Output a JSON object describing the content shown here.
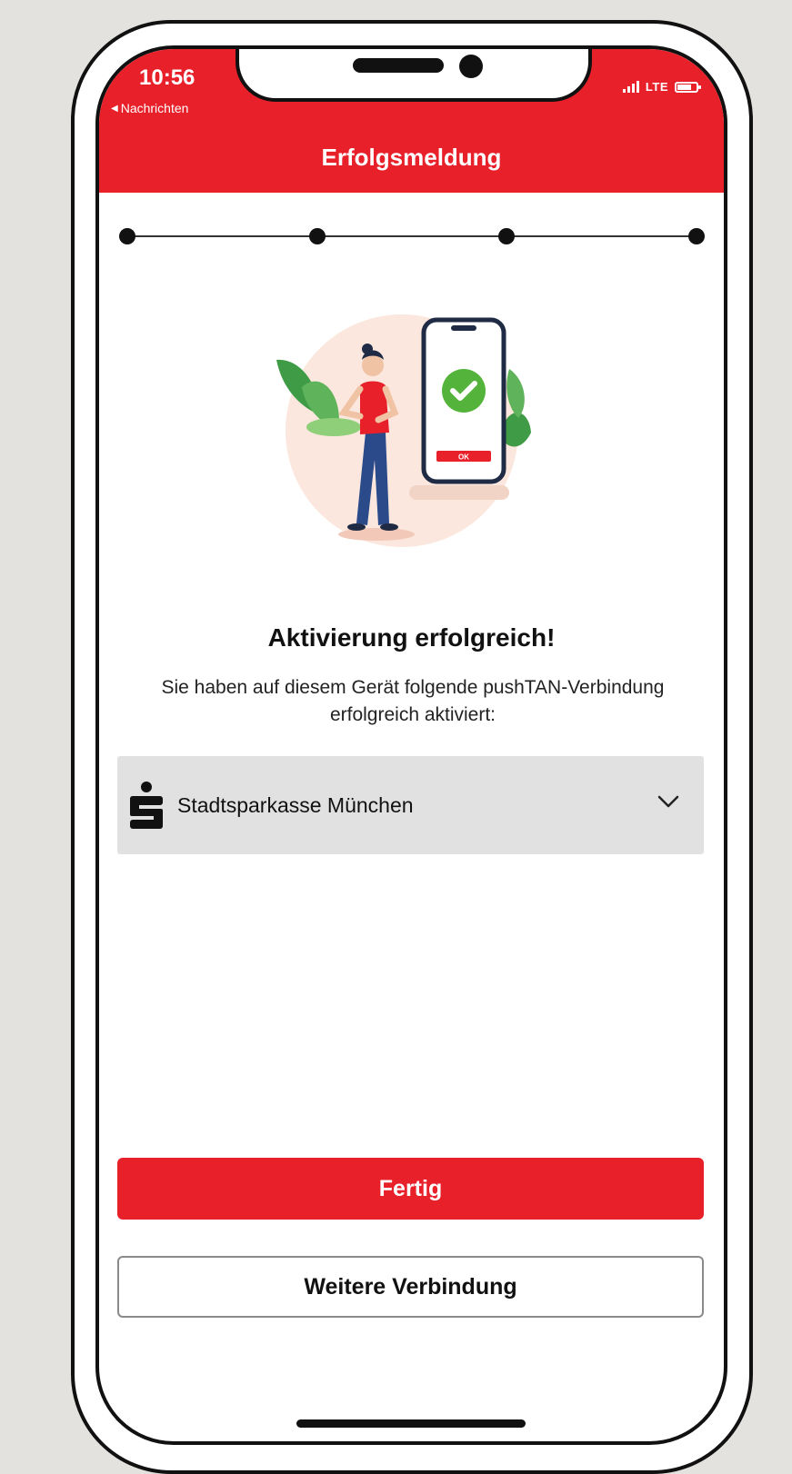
{
  "status_bar": {
    "time": "10:56",
    "back_label": "Nachrichten",
    "network": "LTE"
  },
  "header": {
    "title": "Erfolgsmeldung"
  },
  "stepper": {
    "total_steps": 4,
    "completed_steps": 4
  },
  "illustration": {
    "button_label": "OK",
    "icon": "success-checkmark-icon"
  },
  "main": {
    "headline": "Aktivierung erfolgreich!",
    "description": "Sie haben auf diesem Gerät folgende pushTAN-Verbindung erfolgreich aktiviert:",
    "connection": {
      "label": "Stadtsparkasse München",
      "icon": "sparkasse-logo-icon"
    }
  },
  "actions": {
    "primary_label": "Fertig",
    "secondary_label": "Weitere Verbindung"
  },
  "colors": {
    "brand_red": "#e8202a",
    "success_green": "#53b33b",
    "background": "#e3e2de"
  }
}
